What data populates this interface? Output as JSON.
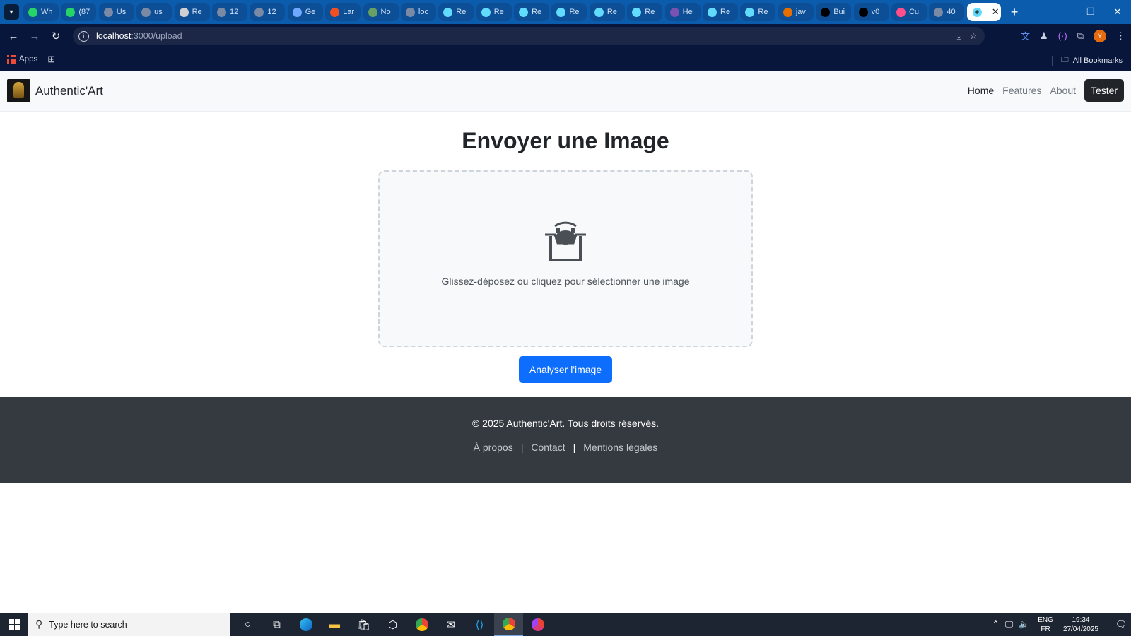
{
  "browser": {
    "tabs": [
      {
        "label": "Wh",
        "favicon": "whatsapp-icon",
        "color": "#25d366"
      },
      {
        "label": "(87",
        "favicon": "whatsapp-icon",
        "color": "#25d366"
      },
      {
        "label": "Us",
        "favicon": "globe-icon",
        "color": "#7a8aa5"
      },
      {
        "label": "us",
        "favicon": "globe-icon",
        "color": "#7a8aa5"
      },
      {
        "label": "Re",
        "favicon": "chrome-icon",
        "color": "#d0d0d0"
      },
      {
        "label": "12",
        "favicon": "globe-icon",
        "color": "#7a8aa5"
      },
      {
        "label": "12",
        "favicon": "globe-icon",
        "color": "#7a8aa5"
      },
      {
        "label": "Ge",
        "favicon": "gemini-icon",
        "color": "#6fa8ff"
      },
      {
        "label": "Lar",
        "favicon": "windows-icon",
        "color": "#f25022"
      },
      {
        "label": "No",
        "favicon": "node-icon",
        "color": "#68a063"
      },
      {
        "label": "loc",
        "favicon": "globe-icon",
        "color": "#7a8aa5"
      },
      {
        "label": "Re",
        "favicon": "react-icon",
        "color": "#61dafb"
      },
      {
        "label": "Re",
        "favicon": "react-icon",
        "color": "#61dafb"
      },
      {
        "label": "Re",
        "favicon": "react-icon",
        "color": "#61dafb"
      },
      {
        "label": "Re",
        "favicon": "react-icon",
        "color": "#61dafb"
      },
      {
        "label": "Re",
        "favicon": "react-icon",
        "color": "#61dafb"
      },
      {
        "label": "Re",
        "favicon": "react-icon",
        "color": "#61dafb"
      },
      {
        "label": "He",
        "favicon": "bootstrap-icon",
        "color": "#7952b3"
      },
      {
        "label": "Re",
        "favicon": "react-icon",
        "color": "#61dafb"
      },
      {
        "label": "Re",
        "favicon": "react-icon",
        "color": "#61dafb"
      },
      {
        "label": "jav",
        "favicon": "java-icon",
        "color": "#e76f00"
      },
      {
        "label": "Bui",
        "favicon": "next-icon",
        "color": "#000000"
      },
      {
        "label": "v0",
        "favicon": "v0-icon",
        "color": "#000000"
      },
      {
        "label": "Cu",
        "favicon": "chart-icon",
        "color": "#ff4f8b"
      },
      {
        "label": "40",
        "favicon": "globe-icon",
        "color": "#7a8aa5"
      }
    ],
    "active_tab_close": "✕",
    "url_host": "localhost",
    "url_path": ":3000/upload",
    "bookmarks_apps": "Apps",
    "all_bookmarks": "All Bookmarks",
    "profile_initial": "Y"
  },
  "navbar": {
    "brand": "Authentic'Art",
    "links": {
      "home": "Home",
      "features": "Features",
      "about": "About"
    },
    "cta": "Tester"
  },
  "main": {
    "title": "Envoyer une Image",
    "dropzone_text": "Glissez-déposez ou cliquez pour sélectionner une image",
    "analyze_button": "Analyser l'image"
  },
  "footer": {
    "copyright": "© 2025 Authentic'Art. Tous droits réservés.",
    "links": {
      "about": "À propos",
      "contact": "Contact",
      "legal": "Mentions légales"
    },
    "separator": "|"
  },
  "taskbar": {
    "search_placeholder": "Type here to search",
    "lang_top": "ENG",
    "lang_bottom": "FR",
    "time": "19:34",
    "date": "27/04/2025"
  },
  "colors": {
    "primary": "#0d6efd",
    "footer_bg": "#343a40",
    "tester_bg": "#212529"
  }
}
